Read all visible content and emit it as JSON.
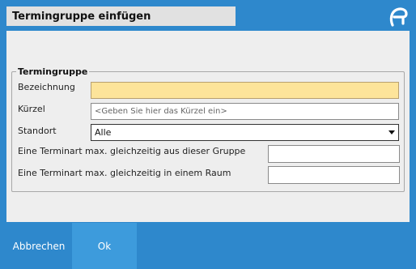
{
  "window": {
    "title": "Termingruppe einfügen"
  },
  "group": {
    "legend": "Termingruppe"
  },
  "form": {
    "bezeichnung_label": "Bezeichnung",
    "bezeichnung_value": "",
    "kuerzel_label": "Kürzel",
    "kuerzel_value": "",
    "kuerzel_placeholder": "<Geben Sie hier das Kürzel ein>",
    "standort_label": "Standort",
    "standort_value": "Alle",
    "max_gruppe_label": "Eine Terminart max. gleichzeitig aus dieser Gruppe",
    "max_gruppe_value": "",
    "max_raum_label": "Eine Terminart max. gleichzeitig in einem Raum",
    "max_raum_value": ""
  },
  "buttons": {
    "cancel": "Abbrechen",
    "ok": "Ok"
  },
  "colors": {
    "background": "#2e88cc",
    "required_field": "#fde49a",
    "ok_button": "#3d9bdc"
  }
}
